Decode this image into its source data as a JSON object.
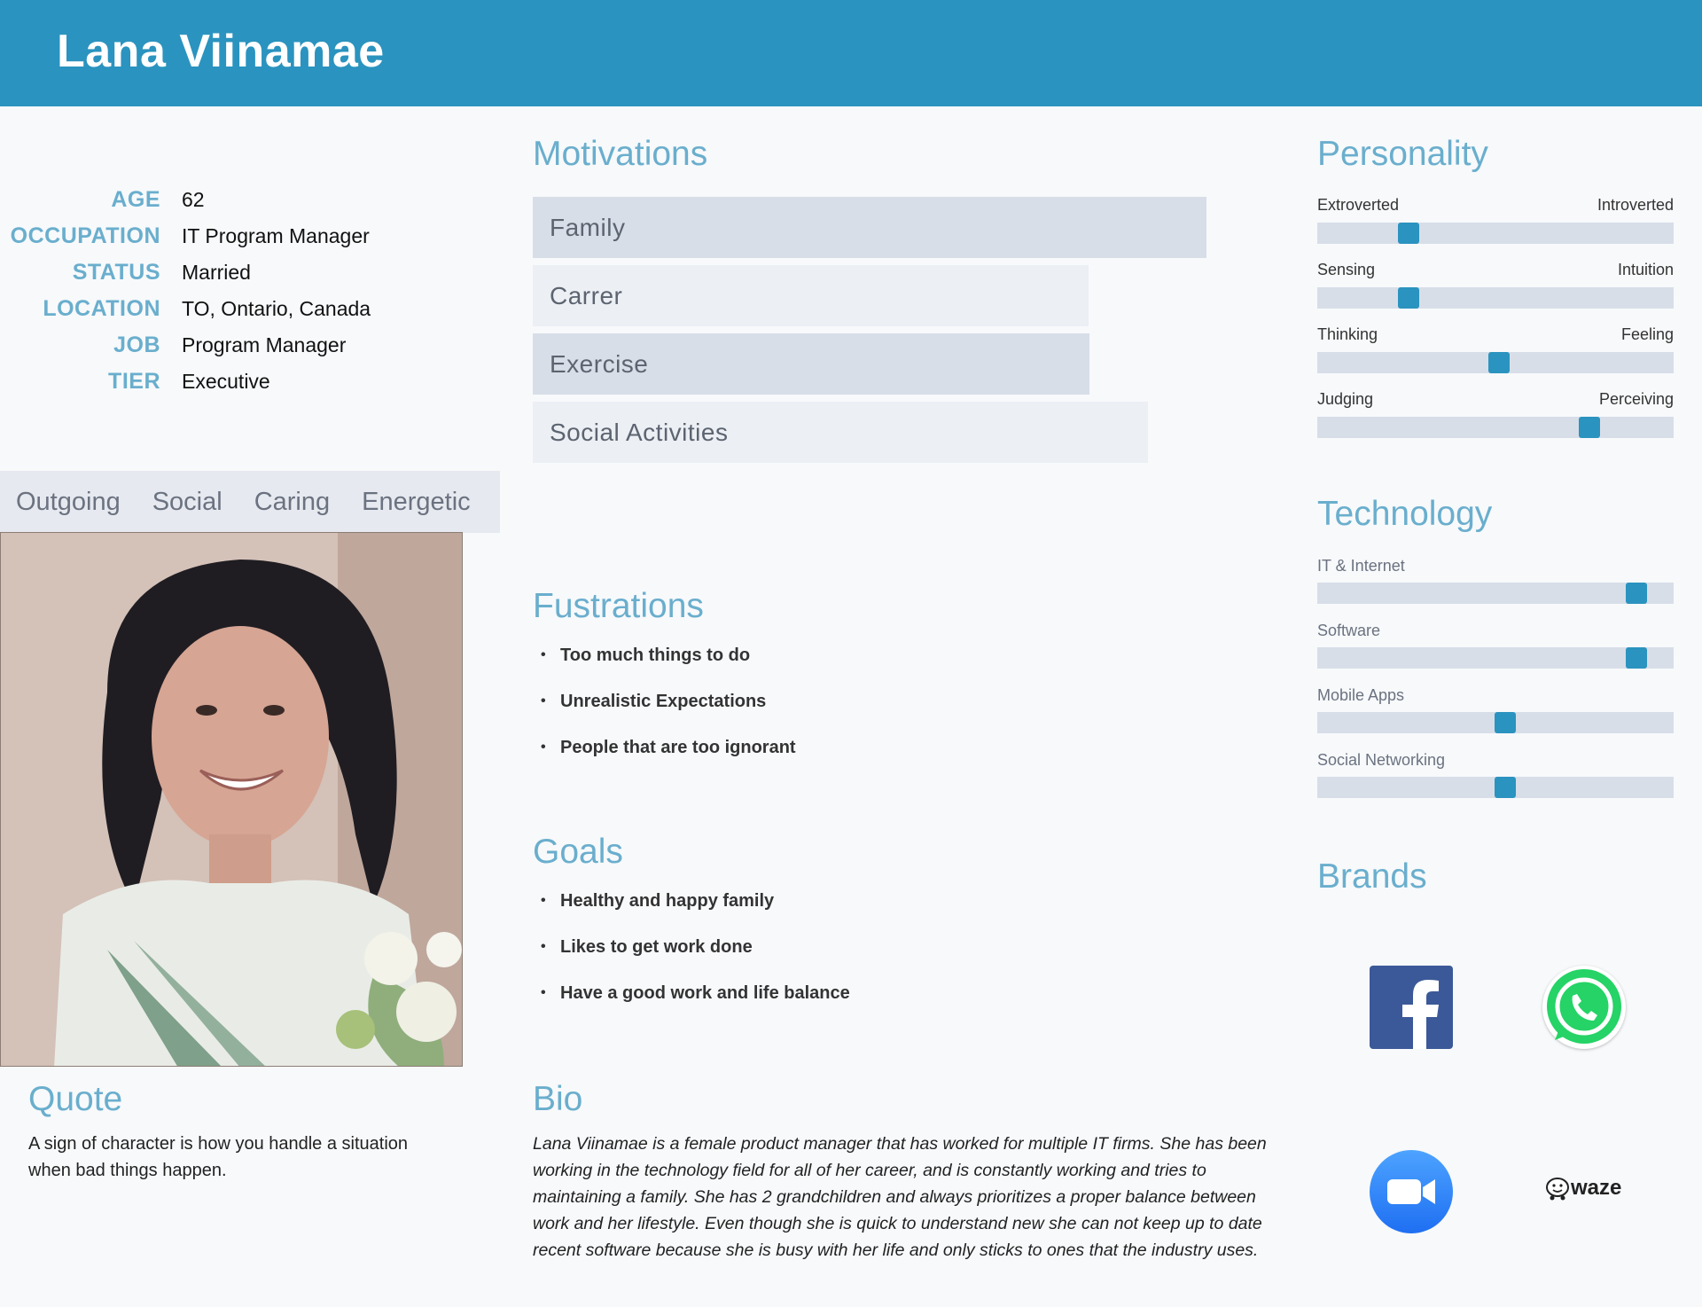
{
  "name": "Lana Viinamae",
  "info": [
    {
      "label": "AGE",
      "value": "62"
    },
    {
      "label": "OCCUPATION",
      "value": "IT Program Manager"
    },
    {
      "label": "STATUS",
      "value": "Married"
    },
    {
      "label": "LOCATION",
      "value": "TO, Ontario, Canada"
    },
    {
      "label": "JOB",
      "value": "Program Manager"
    },
    {
      "label": "TIER",
      "value": "Executive"
    }
  ],
  "traits": [
    "Outgoing",
    "Social",
    "Caring",
    "Energetic"
  ],
  "quote": {
    "title": "Quote",
    "text": "A sign of character is how you handle a situation when bad things happen."
  },
  "motivations": {
    "title": "Motivations",
    "items": [
      {
        "label": "Family",
        "level": 1.0
      },
      {
        "label": "Carrer",
        "level": 0.83
      },
      {
        "label": "Exercise",
        "level": 0.83
      },
      {
        "label": "Social Activities",
        "level": 0.91
      }
    ]
  },
  "frustrations": {
    "title": "Fustrations",
    "items": [
      "Too much things  to do",
      "Unrealistic Expectations",
      "People that are too ignorant"
    ]
  },
  "goals": {
    "title": "Goals",
    "items": [
      "Healthy and happy family",
      "Likes to get work done",
      "Have a good work and life balance"
    ]
  },
  "bio": {
    "title": "Bio",
    "text": "Lana Viinamae is a female product manager that has worked for multiple IT firms. She has been working in the technology field for all of her career, and is constantly working and tries to maintaining a family. She has 2 grandchildren and always prioritizes a proper balance between work and her lifestyle. Even though she is quick to  understand new she can not keep up to date recent software because she is busy with her life and only sticks to ones that the industry uses."
  },
  "personality": {
    "title": "Personality",
    "scales": [
      {
        "left": "Extroverted",
        "right": "Introverted",
        "value": 0.24
      },
      {
        "left": "Sensing",
        "right": "Intuition",
        "value": 0.24
      },
      {
        "left": "Thinking",
        "right": "Feeling",
        "value": 0.51
      },
      {
        "left": "Judging",
        "right": "Perceiving",
        "value": 0.78
      }
    ]
  },
  "technology": {
    "title": "Technology",
    "items": [
      {
        "label": "IT & Internet",
        "value": 0.92
      },
      {
        "label": "Software",
        "value": 0.92
      },
      {
        "label": "Mobile Apps",
        "value": 0.53
      },
      {
        "label": "Social Networking",
        "value": 0.53
      }
    ]
  },
  "brands": {
    "title": "Brands",
    "items": [
      {
        "name": "facebook-icon",
        "color": "#3b5998"
      },
      {
        "name": "whatsapp-icon",
        "color": "#25d366"
      },
      {
        "name": "zoom-icon",
        "color": "#2d8cff"
      },
      {
        "name": "waze-icon",
        "label": "waze"
      }
    ]
  },
  "colors": {
    "accent": "#2b93bf",
    "heading": "#6aaecd",
    "bar": "#d8dee8"
  }
}
